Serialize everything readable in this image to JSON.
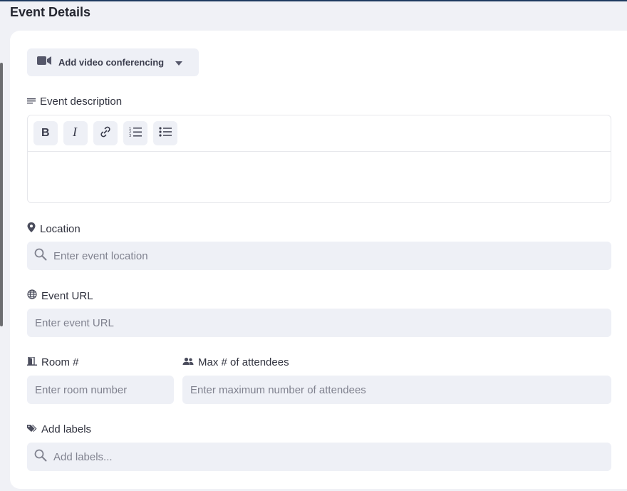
{
  "header": {
    "title": "Event Details"
  },
  "video": {
    "label": "Add video conferencing"
  },
  "description": {
    "label": "Event description",
    "toolbar": [
      "bold-button",
      "italic-button",
      "link-button",
      "ordered-list-button",
      "bullet-list-button"
    ]
  },
  "location": {
    "label": "Location",
    "placeholder": "Enter event location"
  },
  "url": {
    "label": "Event URL",
    "placeholder": "Enter event URL"
  },
  "room": {
    "label": "Room #",
    "placeholder": "Enter room number"
  },
  "attendees": {
    "label": "Max # of attendees",
    "placeholder": "Enter maximum number of attendees"
  },
  "labels": {
    "label": "Add labels",
    "placeholder": "Add labels..."
  },
  "colors": {
    "background": "#f0f1f6",
    "input_bg": "#eef0f6",
    "icon": "#4a4c5c",
    "top_border": "#1e3a5f"
  }
}
